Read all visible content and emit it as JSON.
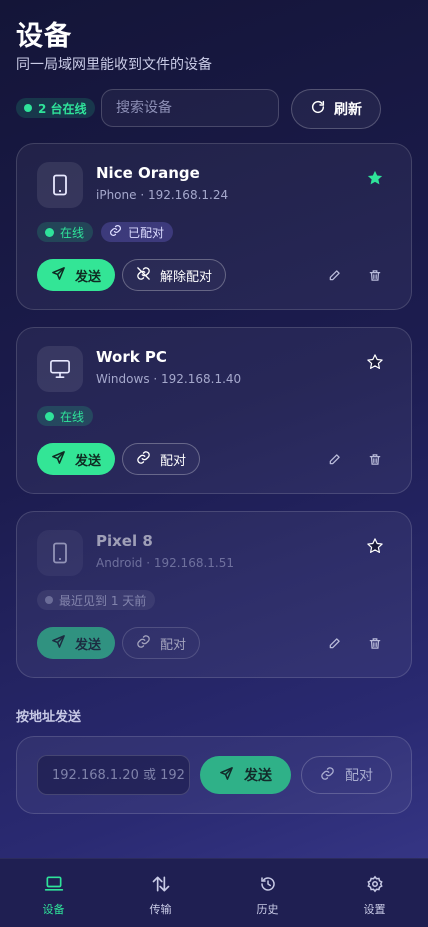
{
  "header": {
    "title": "设备",
    "subtitle": "同一局域网里能收到文件的设备"
  },
  "toolbar": {
    "online_count": "2 台在线",
    "search_placeholder": "搜索设备",
    "refresh_label": "刷新"
  },
  "devices": [
    {
      "name": "Nice Orange",
      "platform": "iPhone · 192.168.1.24",
      "starred": true,
      "status": "在线",
      "pair_tag": "已配对",
      "send_label": "发送",
      "pair_action": "解除配对"
    },
    {
      "name": "Work PC",
      "platform": "Windows · 192.168.1.40",
      "starred": false,
      "status": "在线",
      "send_label": "发送",
      "pair_action": "配对"
    },
    {
      "name": "Pixel 8",
      "platform": "Android · 192.168.1.51",
      "starred": false,
      "status": "最近见到 1 天前",
      "send_label": "发送",
      "pair_action": "配对"
    }
  ],
  "address": {
    "section_label": "按地址发送",
    "input_placeholder": "192.168.1.20 或 192",
    "send_label": "发送",
    "pair_label": "配对"
  },
  "nav": [
    {
      "label": "设备",
      "icon": "laptop-icon",
      "active": true
    },
    {
      "label": "传输",
      "icon": "transfer-arrows-icon",
      "active": false
    },
    {
      "label": "历史",
      "icon": "history-icon",
      "active": false
    },
    {
      "label": "设置",
      "icon": "settings-icon",
      "active": false
    }
  ],
  "colors": {
    "accent": "#33e596",
    "background": "#1c1c4f",
    "star": "#2fe39a"
  }
}
